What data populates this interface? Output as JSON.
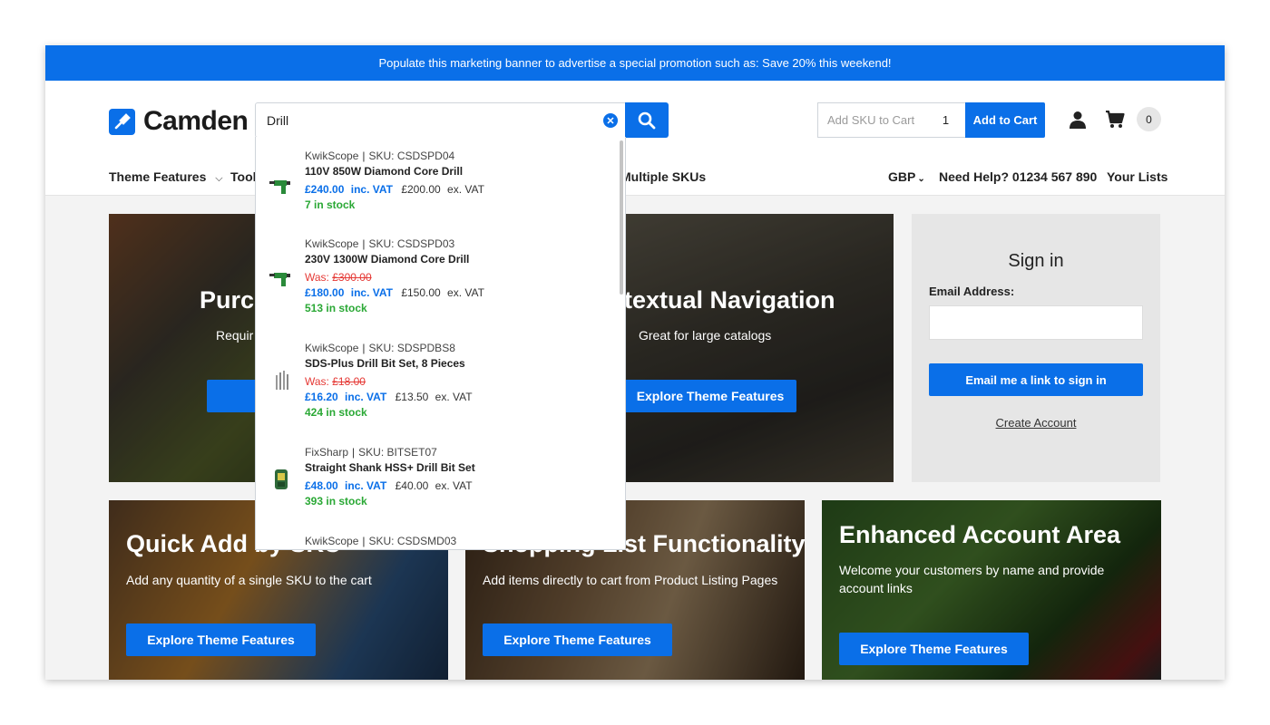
{
  "promo_banner": "Populate this marketing banner to advertise a special promotion such as: Save 20% this weekend!",
  "brand": {
    "name": "Camden",
    "icon": "screwdriver-icon"
  },
  "search": {
    "value": "Drill",
    "clear_icon": "clear-icon",
    "submit_icon": "search-icon"
  },
  "quick_add": {
    "sku_placeholder": "Add SKU to Cart",
    "qty": "1",
    "button": "Add to Cart"
  },
  "header_icons": {
    "account": "account-icon",
    "cart": "cart-icon",
    "cart_count": "0"
  },
  "nav": {
    "theme_features": "Theme Features",
    "tools_partial": "Tool",
    "multiple_skus": "Multiple SKUs",
    "currency": "GBP",
    "help": "Need Help? 01234 567 890",
    "lists": "Your Lists"
  },
  "results": [
    {
      "brand": "KwikScope",
      "sku": "SKU: CSDSPD04",
      "name": "110V 850W Diamond Core Drill",
      "was": "",
      "was_price": "",
      "inc_price": "£240.00",
      "inc_label": "inc. VAT",
      "ex_price": "£200.00",
      "ex_label": "ex. VAT",
      "stock": "7 in stock"
    },
    {
      "brand": "KwikScope",
      "sku": "SKU: CSDSPD03",
      "name": "230V 1300W Diamond Core Drill",
      "was": "Was:",
      "was_price": "£300.00",
      "inc_price": "£180.00",
      "inc_label": "inc. VAT",
      "ex_price": "£150.00",
      "ex_label": "ex. VAT",
      "stock": "513 in stock"
    },
    {
      "brand": "KwikScope",
      "sku": "SKU: SDSPDBS8",
      "name": "SDS-Plus Drill Bit Set, 8 Pieces",
      "was": "Was:",
      "was_price": "£18.00",
      "inc_price": "£16.20",
      "inc_label": "inc. VAT",
      "ex_price": "£13.50",
      "ex_label": "ex. VAT",
      "stock": "424 in stock"
    },
    {
      "brand": "FixSharp",
      "sku": "SKU: BITSET07",
      "name": "Straight Shank HSS+ Drill Bit Set",
      "was": "",
      "was_price": "",
      "inc_price": "£48.00",
      "inc_label": "inc. VAT",
      "ex_price": "£40.00",
      "ex_label": "ex. VAT",
      "stock": "393 in stock"
    },
    {
      "brand": "KwikScope",
      "sku": "SKU: CSDSMD03"
    }
  ],
  "tiles": {
    "purchase": {
      "title": "Purch",
      "sub": "Requir",
      "cta": "Exp"
    },
    "contextual": {
      "title": "textual Navigation",
      "sub": "Great for large catalogs",
      "cta": "Explore Theme Features"
    },
    "quick_add": {
      "title": "Quick Add by SKU",
      "sub": "Add any quantity of a single SKU to the cart",
      "cta": "Explore Theme Features"
    },
    "shopping_list": {
      "title": "Shopping List Functionality",
      "sub": "Add items directly to cart from Product Listing Pages",
      "cta": "Explore Theme Features"
    },
    "account": {
      "title": "Enhanced Account Area",
      "sub": "Welcome your customers by name and provide account links",
      "cta": "Explore Theme Features"
    }
  },
  "signin": {
    "title": "Sign in",
    "email_label": "Email Address:",
    "email_value": "",
    "button": "Email me a link to sign in",
    "create": "Create Account"
  },
  "colors": {
    "accent": "#0a6fe8",
    "stock": "#2aa835",
    "was": "#e53935"
  }
}
